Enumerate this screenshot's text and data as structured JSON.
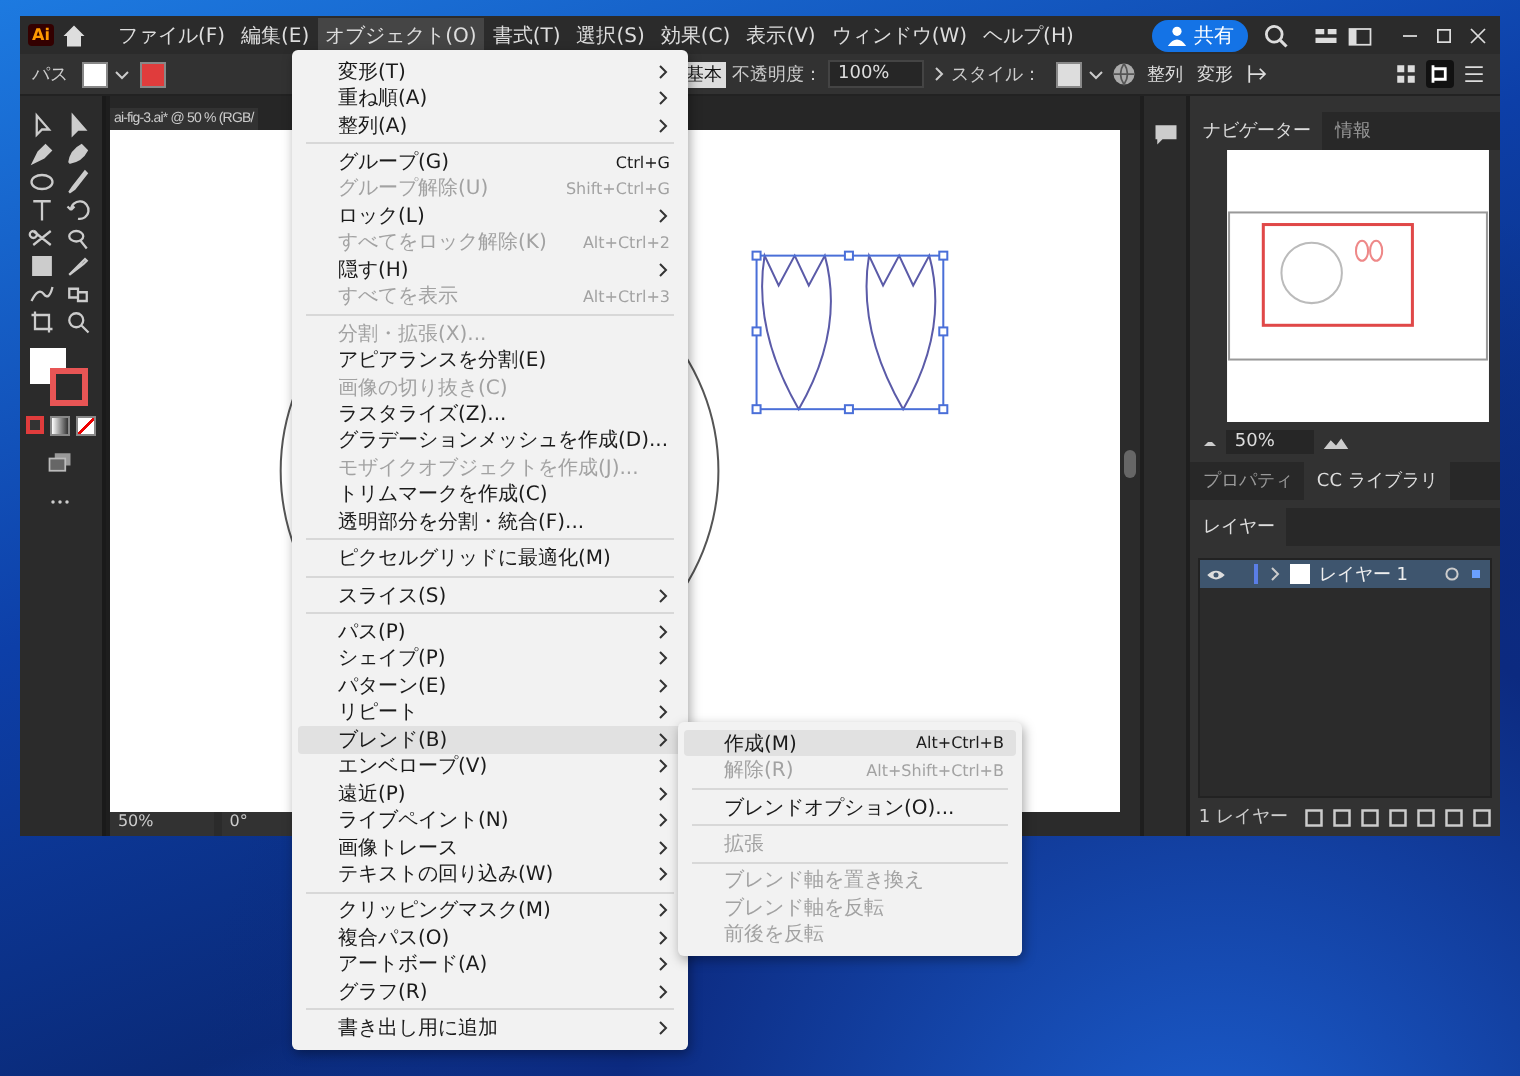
{
  "app": {
    "logo": "Ai",
    "menus": [
      {
        "label": "ファイル(F)",
        "selected": false
      },
      {
        "label": "編集(E)",
        "selected": false
      },
      {
        "label": "オブジェクト(O)",
        "selected": true
      },
      {
        "label": "書式(T)",
        "selected": false
      },
      {
        "label": "選択(S)",
        "selected": false
      },
      {
        "label": "効果(C)",
        "selected": false
      },
      {
        "label": "表示(V)",
        "selected": false
      },
      {
        "label": "ウィンドウ(W)",
        "selected": false
      },
      {
        "label": "ヘルプ(H)",
        "selected": false
      }
    ],
    "share": "共有"
  },
  "control_bar": {
    "object_type": "パス",
    "stroke_style": "基本",
    "opacity_label": "不透明度：",
    "opacity": "100%",
    "style_label": "スタイル：",
    "align": "整列",
    "transform": "変形"
  },
  "document": {
    "tab": "ai-fig-3.ai* @ 50 % (RGB/",
    "zoom": "50%",
    "rotation": "0°"
  },
  "navigator": {
    "tabs": [
      {
        "label": "ナビゲーター",
        "selected": true
      },
      {
        "label": "情報",
        "selected": false
      }
    ],
    "zoom": "50%"
  },
  "library_tabs": [
    {
      "label": "プロパティ",
      "selected": false
    },
    {
      "label": "CC ライブラリ",
      "selected": true
    }
  ],
  "layers": {
    "tab": "レイヤー",
    "rows": [
      {
        "name": "レイヤー 1",
        "visible": true,
        "selected": true
      }
    ],
    "footer": "1 レイヤー"
  },
  "object_menu": {
    "items": [
      {
        "kind": "item",
        "label": "変形(T)",
        "submenu": true,
        "disabled": false,
        "selected": false
      },
      {
        "kind": "item",
        "label": "重ね順(A)",
        "submenu": true,
        "disabled": false,
        "selected": false
      },
      {
        "kind": "item",
        "label": "整列(A)",
        "submenu": true,
        "disabled": false,
        "selected": false
      },
      {
        "kind": "separator"
      },
      {
        "kind": "item",
        "label": "グループ(G)",
        "shortcut": "Ctrl+G",
        "submenu": false,
        "disabled": false,
        "selected": false
      },
      {
        "kind": "item",
        "label": "グループ解除(U)",
        "shortcut": "Shift+Ctrl+G",
        "submenu": false,
        "disabled": true,
        "selected": false
      },
      {
        "kind": "item",
        "label": "ロック(L)",
        "submenu": true,
        "disabled": false,
        "selected": false
      },
      {
        "kind": "item",
        "label": "すべてをロック解除(K)",
        "shortcut": "Alt+Ctrl+2",
        "submenu": false,
        "disabled": true,
        "selected": false
      },
      {
        "kind": "item",
        "label": "隠す(H)",
        "submenu": true,
        "disabled": false,
        "selected": false
      },
      {
        "kind": "item",
        "label": "すべてを表示",
        "shortcut": "Alt+Ctrl+3",
        "submenu": false,
        "disabled": true,
        "selected": false
      },
      {
        "kind": "separator"
      },
      {
        "kind": "item",
        "label": "分割・拡張(X)...",
        "submenu": false,
        "disabled": true,
        "selected": false
      },
      {
        "kind": "item",
        "label": "アピアランスを分割(E)",
        "submenu": false,
        "disabled": false,
        "selected": false
      },
      {
        "kind": "item",
        "label": "画像の切り抜き(C)",
        "submenu": false,
        "disabled": true,
        "selected": false
      },
      {
        "kind": "item",
        "label": "ラスタライズ(Z)...",
        "submenu": false,
        "disabled": false,
        "selected": false
      },
      {
        "kind": "item",
        "label": "グラデーションメッシュを作成(D)...",
        "submenu": false,
        "disabled": false,
        "selected": false
      },
      {
        "kind": "item",
        "label": "モザイクオブジェクトを作成(J)...",
        "submenu": false,
        "disabled": true,
        "selected": false
      },
      {
        "kind": "item",
        "label": "トリムマークを作成(C)",
        "submenu": false,
        "disabled": false,
        "selected": false
      },
      {
        "kind": "item",
        "label": "透明部分を分割・統合(F)...",
        "submenu": false,
        "disabled": false,
        "selected": false
      },
      {
        "kind": "separator"
      },
      {
        "kind": "item",
        "label": "ピクセルグリッドに最適化(M)",
        "submenu": false,
        "disabled": false,
        "selected": false
      },
      {
        "kind": "separator"
      },
      {
        "kind": "item",
        "label": "スライス(S)",
        "submenu": true,
        "disabled": false,
        "selected": false
      },
      {
        "kind": "separator"
      },
      {
        "kind": "item",
        "label": "パス(P)",
        "submenu": true,
        "disabled": false,
        "selected": false
      },
      {
        "kind": "item",
        "label": "シェイプ(P)",
        "submenu": true,
        "disabled": false,
        "selected": false
      },
      {
        "kind": "item",
        "label": "パターン(E)",
        "submenu": true,
        "disabled": false,
        "selected": false
      },
      {
        "kind": "item",
        "label": "リピート",
        "submenu": true,
        "disabled": false,
        "selected": false
      },
      {
        "kind": "item",
        "label": "ブレンド(B)",
        "submenu": true,
        "disabled": false,
        "selected": true
      },
      {
        "kind": "item",
        "label": "エンベロープ(V)",
        "submenu": true,
        "disabled": false,
        "selected": false
      },
      {
        "kind": "item",
        "label": "遠近(P)",
        "submenu": true,
        "disabled": false,
        "selected": false
      },
      {
        "kind": "item",
        "label": "ライブペイント(N)",
        "submenu": true,
        "disabled": false,
        "selected": false
      },
      {
        "kind": "item",
        "label": "画像トレース",
        "submenu": true,
        "disabled": false,
        "selected": false
      },
      {
        "kind": "item",
        "label": "テキストの回り込み(W)",
        "submenu": true,
        "disabled": false,
        "selected": false
      },
      {
        "kind": "separator"
      },
      {
        "kind": "item",
        "label": "クリッピングマスク(M)",
        "submenu": true,
        "disabled": false,
        "selected": false
      },
      {
        "kind": "item",
        "label": "複合パス(O)",
        "submenu": true,
        "disabled": false,
        "selected": false
      },
      {
        "kind": "item",
        "label": "アートボード(A)",
        "submenu": true,
        "disabled": false,
        "selected": false
      },
      {
        "kind": "item",
        "label": "グラフ(R)",
        "submenu": true,
        "disabled": false,
        "selected": false
      },
      {
        "kind": "separator"
      },
      {
        "kind": "item",
        "label": "書き出し用に追加",
        "submenu": true,
        "disabled": false,
        "selected": false
      }
    ]
  },
  "blend_submenu": {
    "items": [
      {
        "kind": "item",
        "label": "作成(M)",
        "shortcut": "Alt+Ctrl+B",
        "disabled": false,
        "selected": true
      },
      {
        "kind": "item",
        "label": "解除(R)",
        "shortcut": "Alt+Shift+Ctrl+B",
        "disabled": true,
        "selected": false
      },
      {
        "kind": "separator"
      },
      {
        "kind": "item",
        "label": "ブレンドオプション(O)...",
        "disabled": false,
        "selected": false
      },
      {
        "kind": "separator"
      },
      {
        "kind": "item",
        "label": "拡張",
        "disabled": true,
        "selected": false
      },
      {
        "kind": "separator"
      },
      {
        "kind": "item",
        "label": "ブレンド軸を置き換え",
        "disabled": true,
        "selected": false
      },
      {
        "kind": "item",
        "label": "ブレンド軸を反転",
        "disabled": true,
        "selected": false
      },
      {
        "kind": "item",
        "label": "前後を反転",
        "disabled": true,
        "selected": false
      }
    ]
  }
}
